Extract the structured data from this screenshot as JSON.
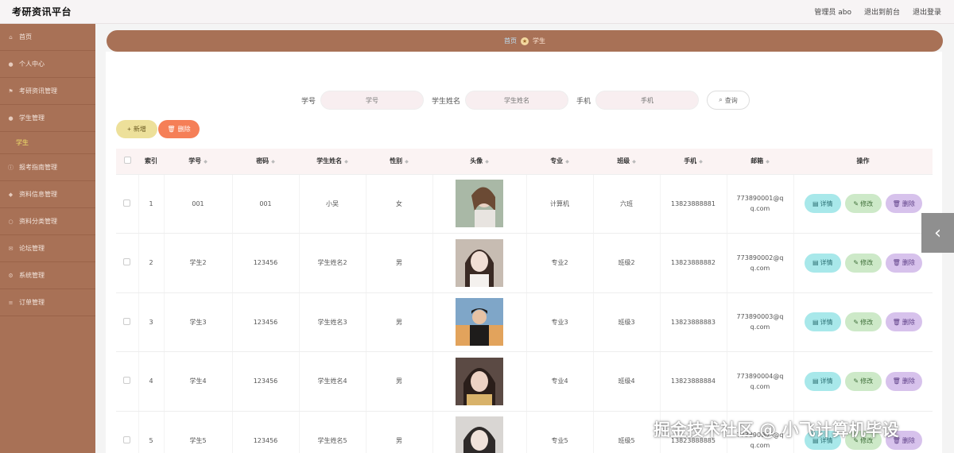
{
  "app": {
    "title": "考研资讯平台"
  },
  "topbar": {
    "admin_label": "管理员 abo",
    "back_to_front": "退出到前台",
    "logout": "退出登录"
  },
  "sidebar": {
    "items": [
      {
        "label": "首页",
        "icon": "home-icon"
      },
      {
        "label": "个人中心",
        "icon": "user-icon"
      },
      {
        "label": "考研资讯管理",
        "icon": "flag-icon"
      },
      {
        "label": "学生管理",
        "icon": "user-icon"
      }
    ],
    "sub_item": "学生",
    "items2": [
      {
        "label": "报考指南管理",
        "icon": "info-icon"
      },
      {
        "label": "资料信息管理",
        "icon": "shield-icon"
      },
      {
        "label": "资料分类管理",
        "icon": "circle-icon"
      },
      {
        "label": "论坛管理",
        "icon": "chat-icon"
      },
      {
        "label": "系统管理",
        "icon": "gear-icon"
      },
      {
        "label": "订单管理",
        "icon": "list-icon"
      }
    ]
  },
  "breadcrumb": {
    "home": "首页",
    "current": "学生"
  },
  "search": {
    "fields": [
      {
        "label": "学号",
        "placeholder": "学号"
      },
      {
        "label": "学生姓名",
        "placeholder": "学生姓名"
      },
      {
        "label": "手机",
        "placeholder": "手机"
      }
    ],
    "button": "查询"
  },
  "actions": {
    "add": "新增",
    "delete": "删除"
  },
  "table": {
    "headers": [
      "索引",
      "学号",
      "密码",
      "学生姓名",
      "性别",
      "头像",
      "专业",
      "班级",
      "手机",
      "邮箱",
      "操作"
    ],
    "rows": [
      {
        "index": "1",
        "id": "001",
        "password": "001",
        "name": "小吴",
        "gender": "女",
        "major": "计算机",
        "class": "六班",
        "phone": "13823888881",
        "email": "773890001@qq.com",
        "avatar_color": "#7a8c76"
      },
      {
        "index": "2",
        "id": "学生2",
        "password": "123456",
        "name": "学生姓名2",
        "gender": "男",
        "major": "专业2",
        "class": "班级2",
        "phone": "13823888882",
        "email": "773890002@qq.com",
        "avatar_color": "#b9a99c"
      },
      {
        "index": "3",
        "id": "学生3",
        "password": "123456",
        "name": "学生姓名3",
        "gender": "男",
        "major": "专业3",
        "class": "班级3",
        "phone": "13823888883",
        "email": "773890003@qq.com",
        "avatar_color": "#d79b5a"
      },
      {
        "index": "4",
        "id": "学生4",
        "password": "123456",
        "name": "学生姓名4",
        "gender": "男",
        "major": "专业4",
        "class": "班级4",
        "phone": "13823888884",
        "email": "773890004@qq.com",
        "avatar_color": "#8a5a4a"
      },
      {
        "index": "5",
        "id": "学生5",
        "password": "123456",
        "name": "学生姓名5",
        "gender": "男",
        "major": "专业5",
        "class": "班级5",
        "phone": "13823888885",
        "email": "773890005@qq.com",
        "avatar_color": "#6b6562"
      }
    ],
    "ops": {
      "detail": "详情",
      "edit": "修改",
      "delete": "删除"
    }
  },
  "watermark": "掘金技术社区 @ 小飞计算机毕设",
  "colors": {
    "sidebar": "#a87156",
    "accent_add": "#ede09a",
    "accent_delete": "#f57f57"
  }
}
